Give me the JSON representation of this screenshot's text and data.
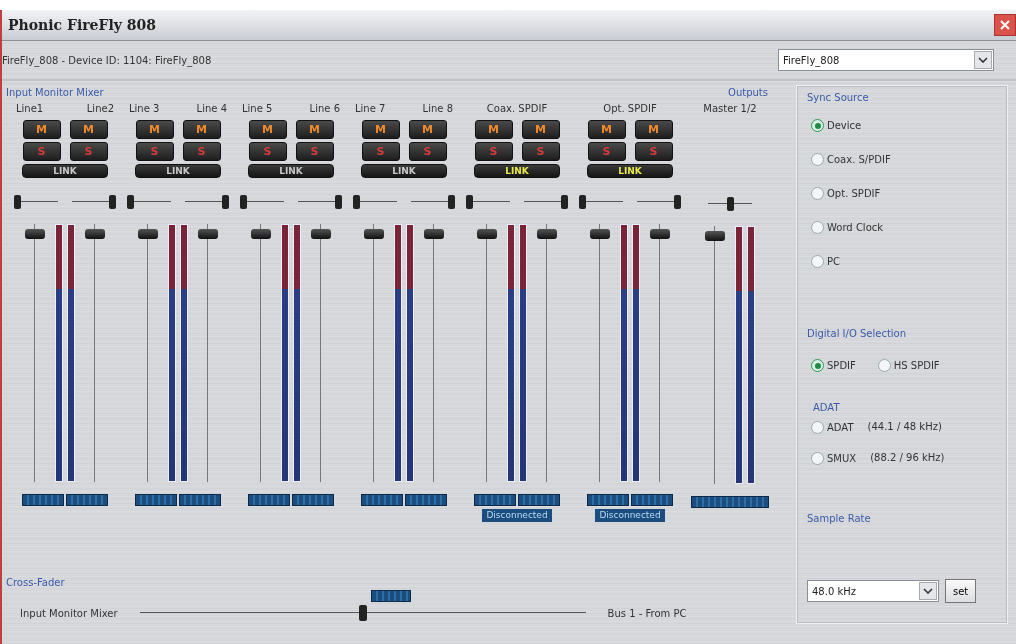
{
  "window": {
    "title": "Phonic FireFly 808"
  },
  "device_line": "FireFly_808 - Device ID: 1104: FireFly_808",
  "device_select": {
    "value": "FireFly_808"
  },
  "mixer": {
    "title": "Input Monitor Mixer",
    "groups": [
      {
        "kind": "pair",
        "labels": [
          "Line1",
          "Line2"
        ],
        "link": {
          "text": "LINK",
          "on": false
        },
        "channels": [
          {
            "mute": {
              "text": "M",
              "on": true
            },
            "solo": {
              "text": "S",
              "on": false
            },
            "pan": {
              "level": 0
            },
            "fader": {
              "level": 0.98
            }
          },
          {
            "mute": {
              "text": "M",
              "on": true
            },
            "solo": {
              "text": "S",
              "on": false
            },
            "pan": {
              "level": 1
            },
            "fader": {
              "level": 0.98
            }
          }
        ]
      },
      {
        "kind": "pair",
        "labels": [
          "Line 3",
          "Line 4"
        ],
        "link": {
          "text": "LINK",
          "on": false
        },
        "channels": [
          {
            "mute": {
              "text": "M",
              "on": true
            },
            "solo": {
              "text": "S",
              "on": false
            },
            "pan": {
              "level": 0
            },
            "fader": {
              "level": 0.98
            }
          },
          {
            "mute": {
              "text": "M",
              "on": true
            },
            "solo": {
              "text": "S",
              "on": false
            },
            "pan": {
              "level": 1
            },
            "fader": {
              "level": 0.98
            }
          }
        ]
      },
      {
        "kind": "pair",
        "labels": [
          "Line 5",
          "Line 6"
        ],
        "link": {
          "text": "LINK",
          "on": false
        },
        "channels": [
          {
            "mute": {
              "text": "M",
              "on": true
            },
            "solo": {
              "text": "S",
              "on": false
            },
            "pan": {
              "level": 0
            },
            "fader": {
              "level": 0.98
            }
          },
          {
            "mute": {
              "text": "M",
              "on": true
            },
            "solo": {
              "text": "S",
              "on": false
            },
            "pan": {
              "level": 1
            },
            "fader": {
              "level": 0.98
            }
          }
        ]
      },
      {
        "kind": "pair",
        "labels": [
          "Line 7",
          "Line 8"
        ],
        "link": {
          "text": "LINK",
          "on": false
        },
        "channels": [
          {
            "mute": {
              "text": "M",
              "on": true
            },
            "solo": {
              "text": "S",
              "on": false
            },
            "pan": {
              "level": 0
            },
            "fader": {
              "level": 0.98
            }
          },
          {
            "mute": {
              "text": "M",
              "on": true
            },
            "solo": {
              "text": "S",
              "on": false
            },
            "pan": {
              "level": 1
            },
            "fader": {
              "level": 0.98
            }
          }
        ]
      },
      {
        "kind": "stereo",
        "labels": [
          "Coax. SPDIF"
        ],
        "link": {
          "text": "LINK",
          "on": true
        },
        "status": "Disconnected",
        "channels": [
          {
            "mute": {
              "text": "M",
              "on": true
            },
            "solo": {
              "text": "S",
              "on": false
            },
            "pan": {
              "level": 0
            },
            "fader": {
              "level": 0.98
            }
          },
          {
            "mute": {
              "text": "M",
              "on": true
            },
            "solo": {
              "text": "S",
              "on": false
            },
            "pan": {
              "level": 1
            },
            "fader": {
              "level": 0.98
            }
          }
        ]
      },
      {
        "kind": "stereo",
        "labels": [
          "Opt. SPDIF"
        ],
        "link": {
          "text": "LINK",
          "on": true
        },
        "status": "Disconnected",
        "channels": [
          {
            "mute": {
              "text": "M",
              "on": true
            },
            "solo": {
              "text": "S",
              "on": false
            },
            "pan": {
              "level": 0
            },
            "fader": {
              "level": 0.98
            }
          },
          {
            "mute": {
              "text": "M",
              "on": true
            },
            "solo": {
              "text": "S",
              "on": false
            },
            "pan": {
              "level": 1
            },
            "fader": {
              "level": 0.98
            }
          }
        ]
      }
    ],
    "outputs": {
      "title": "Outputs",
      "label": "Master 1/2",
      "pan": {
        "level": 0.5
      },
      "fader": {
        "level": 0.98
      }
    }
  },
  "cross_fader": {
    "title": "Cross-Fader",
    "left_label": "Input Monitor Mixer",
    "right_label": "Bus 1 - From PC",
    "level": 0.5
  },
  "sync_source": {
    "title": "Sync Source",
    "options": [
      {
        "label": "Device",
        "selected": true
      },
      {
        "label": "Coax. S/PDIF",
        "selected": false
      },
      {
        "label": "Opt. SPDIF",
        "selected": false
      },
      {
        "label": "Word Clock",
        "selected": false
      },
      {
        "label": "PC",
        "selected": false
      }
    ]
  },
  "digital_io": {
    "title": "Digital I/O Selection",
    "options": [
      {
        "label": "SPDIF",
        "selected": true
      },
      {
        "label": "HS SPDIF",
        "selected": false
      }
    ]
  },
  "adat": {
    "title": "ADAT",
    "options": [
      {
        "label": "ADAT",
        "detail": "(44.1 / 48 kHz)",
        "selected": false
      },
      {
        "label": "SMUX",
        "detail": "(88.2 / 96 kHz)",
        "selected": false
      }
    ]
  },
  "sample_rate": {
    "title": "Sample Rate",
    "value": "48.0 kHz",
    "button": "set"
  }
}
